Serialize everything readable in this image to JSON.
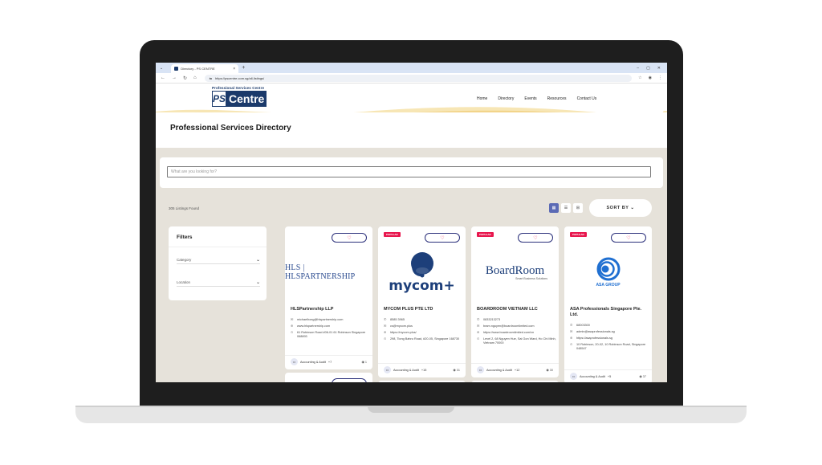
{
  "browser": {
    "tab_title": "Directory - PS CENTRE",
    "tab_close": "×",
    "new_tab": "+",
    "url": "https://pscentre.com.sg/all-listings/",
    "window_controls": [
      "–",
      "▢",
      "✕"
    ]
  },
  "site": {
    "logo_top": "Professional Services Centre",
    "logo_ps": "PS",
    "logo_centre": "Centre",
    "nav": [
      "Home",
      "Directory",
      "Events",
      "Resources",
      "Contact Us"
    ]
  },
  "page": {
    "title": "Professional Services Directory",
    "search_placeholder": "What are you looking for?",
    "listings_found": "305 Listings Found",
    "sort_label": "SORT BY ⌄"
  },
  "filters": {
    "title": "Filters",
    "fields": [
      "Category",
      "Location"
    ]
  },
  "colors": {
    "brand_navy": "#1b3a6b",
    "accent_red": "#e8174e",
    "view_active": "#5b6ab5",
    "content_bg": "#e6e2da",
    "wave_gold": "#f2d48a"
  },
  "listings": [
    {
      "name": "HLSPartnership LLP",
      "logo_text": "HLS | HLSPARTNERSHIP",
      "popular": false,
      "email": "michaelhong@hlspartnership.com",
      "website": "www.hlspartnership.com",
      "address": "61 Robinson Road #06-01 61 Robinson Singapore 068893",
      "category": "Accounting & Audit",
      "more": "+7",
      "views": "1"
    },
    {
      "name": "MYCOM PLUS PTE LTD",
      "logo_text": "mycom+",
      "popular": true,
      "badge": "POPULAR",
      "phone": "8585 3965",
      "email": "cs@mycom.plus",
      "website": "https://mycom.plus/",
      "address": "298, Tiong Bahru Road, #20-05, Singapore 168730",
      "category": "Accounting & Audit",
      "more": "+15",
      "views": "31"
    },
    {
      "name": "BOARDROOM VIETNAM LLC",
      "logo_text": "BoardRoom",
      "logo_sub": "Smart Business Solutions",
      "popular": true,
      "badge": "POPULAR",
      "phone": "0833213273",
      "email": "bram.nguyen@boardroomlimited.com",
      "website": "https://www.boardroomlimited.com/vn",
      "address": "Level 2, 68 Nguyen Hue, Sai Gon Ward, Ho Chi Minh, Vietnam 70000",
      "category": "Accounting & Audit",
      "more": "+12",
      "views": "30"
    },
    {
      "name": "ASA Professionals Singapore Pte. Ltd.",
      "logo_text": "ASA GROUP",
      "popular": true,
      "badge": "POPULAR",
      "phone": "68003300",
      "email": "admin@asaprofessionals.sg",
      "website": "https://asaprofessionals.sg",
      "address": "10 Robinson, 20-02, 10 Robinson Road, Singapore 048547",
      "category": "Accounting & Audit",
      "more": "+5",
      "views": "37"
    }
  ]
}
